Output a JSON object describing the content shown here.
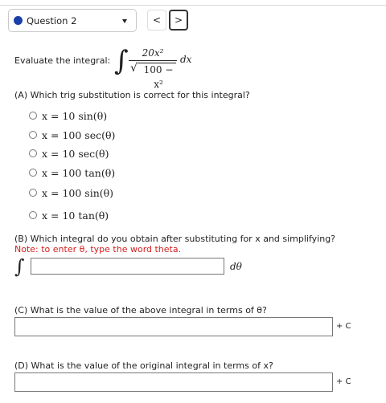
{
  "header": {
    "question_label": "Question 2",
    "prev_label": "<",
    "next_label": ">"
  },
  "prompt": {
    "evaluate_label": "Evaluate the integral:",
    "integral_symbol": "∫",
    "numerator": "20x²",
    "denominator_radicand": "100 − x²",
    "sqrt_symbol": "√",
    "differential": "dx"
  },
  "part_a": {
    "question": "(A) Which trig substitution is correct for this integral?",
    "options": [
      "x = 10 sin(θ)",
      "x = 100 sec(θ)",
      "x = 10 sec(θ)",
      "x = 100 tan(θ)",
      "x = 100 sin(θ)",
      "x = 10 tan(θ)"
    ]
  },
  "part_b": {
    "question": "(B) Which integral do you obtain after substituting for x and simplifying?",
    "note": "Note: to enter θ, type the word theta.",
    "integral_symbol": "∫",
    "input_value": "",
    "differential": "dθ"
  },
  "part_c": {
    "question": "(C) What is the value of the above integral in terms of θ?",
    "input_value": "",
    "constant": "+ C"
  },
  "part_d": {
    "question": "(D) What is the value of the original integral in terms of x?",
    "input_value": "",
    "constant": "+ C"
  },
  "colors": {
    "accent_dot": "#1a3fa8",
    "note_red": "#d42020",
    "border": "#777777"
  }
}
